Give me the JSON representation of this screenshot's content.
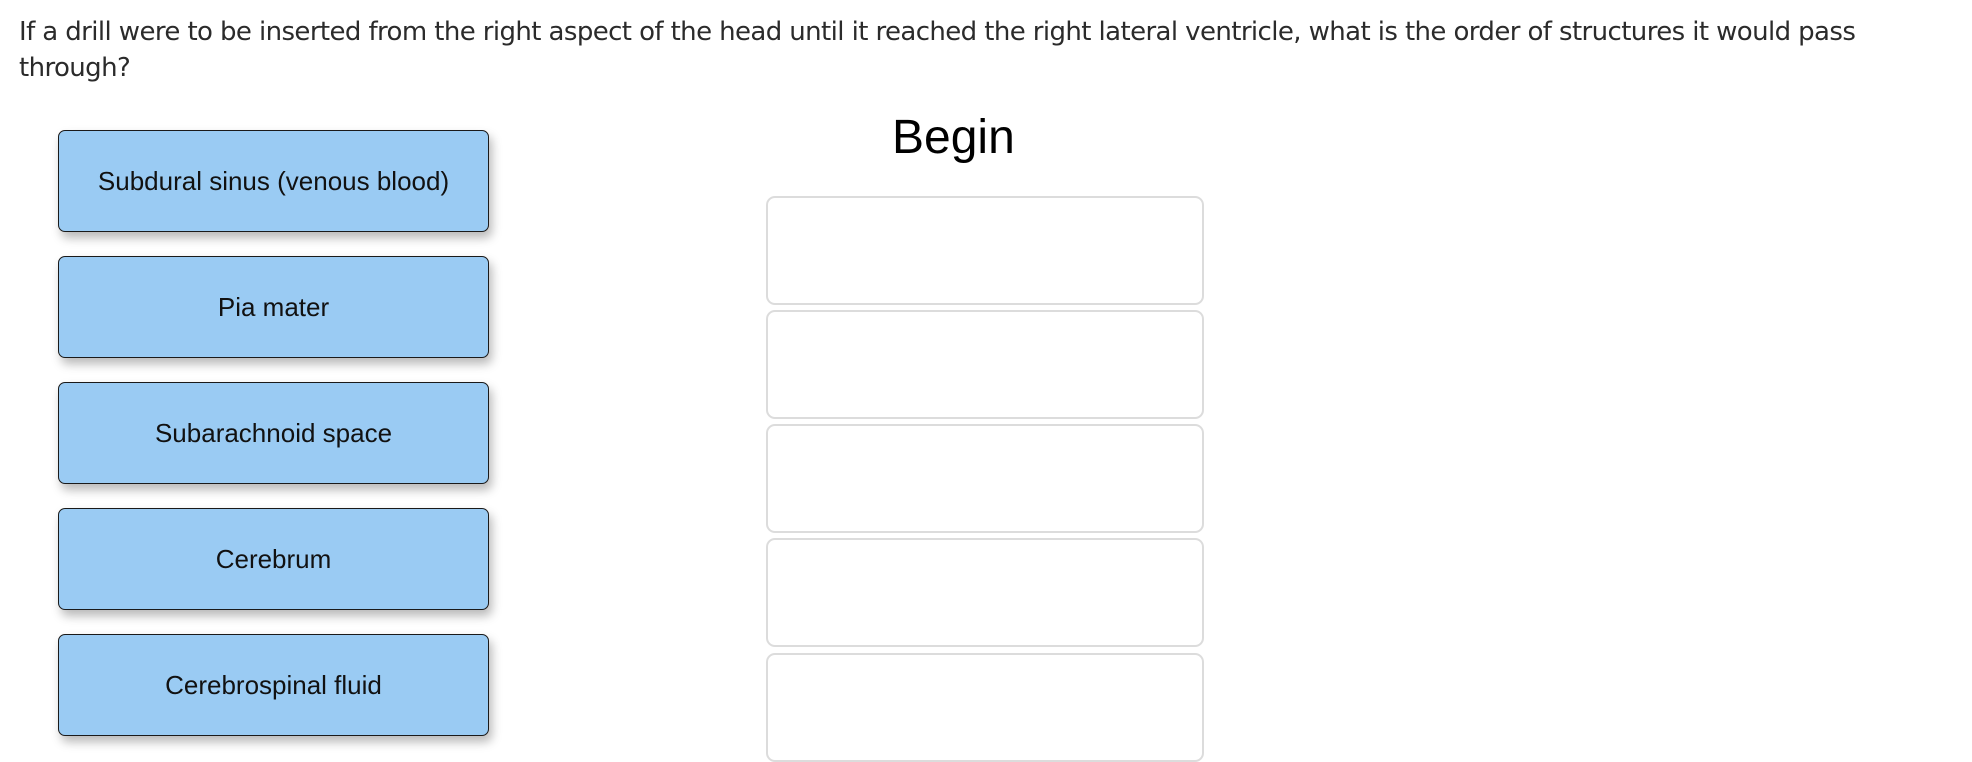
{
  "question": {
    "text": "If a drill were to be inserted from the right aspect of the head until it reached the right lateral ventricle, what is the order of structures it would pass through?"
  },
  "options": [
    {
      "label": "Subdural sinus (venous blood)"
    },
    {
      "label": "Pia mater"
    },
    {
      "label": "Subarachnoid space"
    },
    {
      "label": "Cerebrum"
    },
    {
      "label": "Cerebrospinal fluid"
    }
  ],
  "target": {
    "heading": "Begin",
    "slots": [
      {
        "value": ""
      },
      {
        "value": ""
      },
      {
        "value": ""
      },
      {
        "value": ""
      },
      {
        "value": ""
      }
    ]
  },
  "colors": {
    "tile_fill": "#9acbf3",
    "tile_border": "#1a1a1a",
    "slot_border": "#dcdcdc"
  }
}
